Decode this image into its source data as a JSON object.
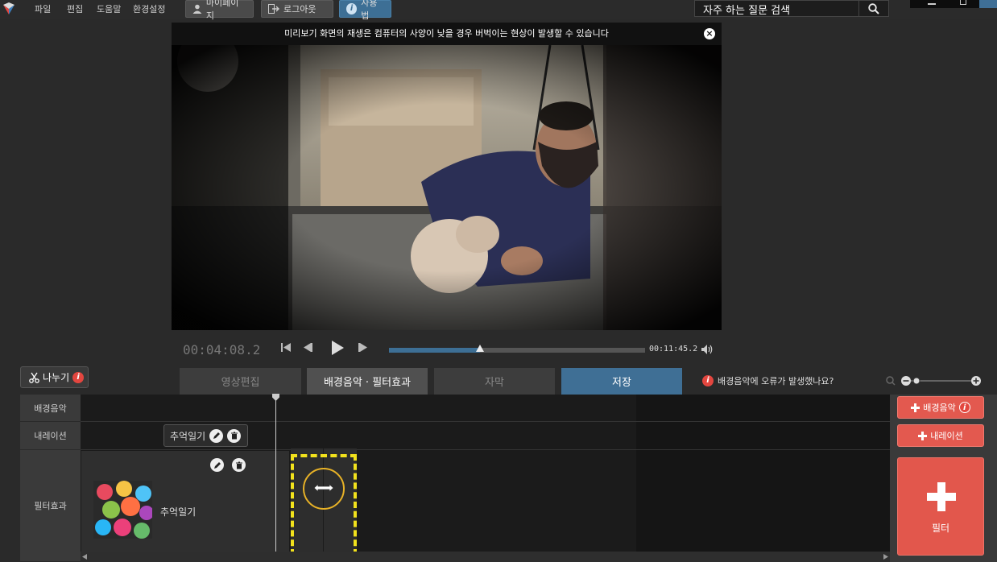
{
  "menu": {
    "file": "파일",
    "edit": "편집",
    "help": "도움말",
    "settings": "환경설정"
  },
  "toolbar": {
    "mypage": "마이페이지",
    "logout": "로그아웃",
    "guide": "사용법"
  },
  "search": {
    "placeholder": "자주 하는 질문 검색"
  },
  "preview": {
    "notice": "미리보기 화면의 재생은 컴퓨터의 사양이 낮을 경우 버벅이는 현상이 발생할 수 있습니다"
  },
  "playback": {
    "current_time": "00:04:08.2",
    "end_time": "00:11:45.2",
    "progress": 0.355
  },
  "split": {
    "label": "나누기"
  },
  "tabs": [
    {
      "label": "영상편집"
    },
    {
      "label": "배경음악 · 필터효과"
    },
    {
      "label": "자막"
    },
    {
      "label": "저장"
    }
  ],
  "music_error": {
    "label": "배경음악에 오류가 발생했나요?"
  },
  "tracks": {
    "music": "배경음악",
    "narration": "내레이션",
    "filter": "필터효과"
  },
  "clip_tooltip": {
    "label": "추억일기"
  },
  "filter_clip": {
    "name": "추억일기"
  },
  "right_panel": {
    "add_music": "배경음악",
    "add_narration": "내레이션",
    "add_filter": "필터"
  },
  "colors": {
    "accent_blue": "#3f6f95",
    "add_red": "#e3594f",
    "highlight_yellow": "#f2e21c",
    "circle_orange": "#e8b227"
  },
  "icons": [
    "logo-icon",
    "user-icon",
    "logout-icon",
    "info-icon",
    "search-icon",
    "close-icon",
    "skip-start-icon",
    "step-back-icon",
    "play-icon",
    "step-forward-icon",
    "volume-icon",
    "scissors-icon",
    "zoom-icon",
    "pencil-icon",
    "trash-icon",
    "resize-icon",
    "plus-icon"
  ]
}
